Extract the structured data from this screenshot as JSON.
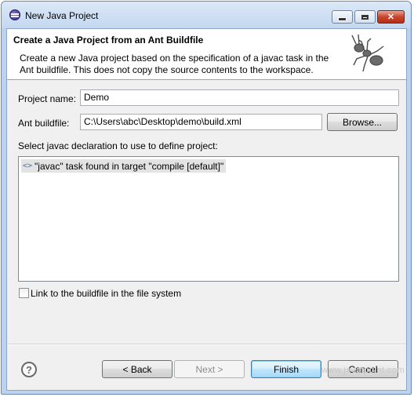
{
  "window": {
    "title": "New Java Project"
  },
  "banner": {
    "title": "Create a Java Project from an Ant Buildfile",
    "description": "Create a new Java project based on the specification of a javac task in the Ant buildfile. This does not copy the source contents to the workspace.",
    "icon": "ant-icon"
  },
  "form": {
    "project_name_label": "Project name:",
    "project_name_value": "Demo",
    "buildfile_label": "Ant buildfile:",
    "buildfile_value": "C:\\Users\\abc\\Desktop\\demo\\build.xml",
    "browse_label": "Browse...",
    "select_label": "Select javac declaration to use to define project:",
    "javac_items": [
      {
        "label": "\"javac\" task found in target \"compile [default]\"",
        "icon": "xml-tag-icon"
      }
    ],
    "link_checkbox_label": "Link to the buildfile in the file system",
    "link_checked": false
  },
  "footer": {
    "help_icon": "help-icon",
    "back_label": "< Back",
    "next_label": "Next >",
    "finish_label": "Finish",
    "cancel_label": "Cancel",
    "watermark": "www.javatpoint.com"
  },
  "colors": {
    "title_bar": "#c3d8f0",
    "dialog_bg": "#f0f0f0",
    "close_button": "#c9452d"
  }
}
